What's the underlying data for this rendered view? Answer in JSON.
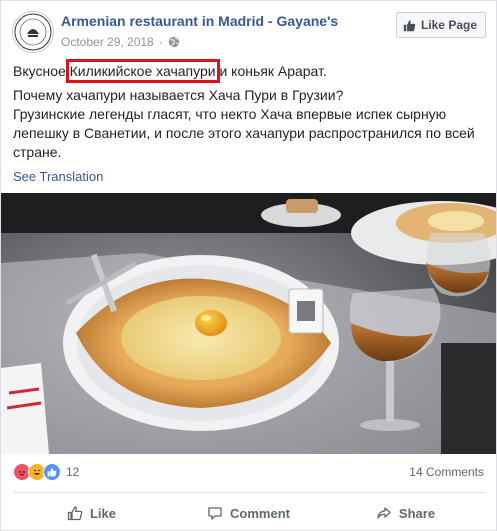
{
  "header": {
    "page_name": "Armenian restaurant in Madrid - Gayane's",
    "date": "October 29, 2018",
    "separator": "·",
    "like_page_label": "Like Page",
    "avatar_text": "GAYANE'S MADRID"
  },
  "post": {
    "line1_prefix": "Вкусное ",
    "line1_highlight": "Киликийское хачапури",
    "line1_suffix": " и коньяк Арарат.",
    "line2": "Почему хачапури называется Хача Пури в Грузии?",
    "line3": "Грузинские легенды гласят, что некто Хача впервые испек сырную лепешку в Сванетии, и после этого хачапури распространился по всей стране.",
    "see_translation": "See Translation",
    "highlight_color": "#e0101b"
  },
  "stats": {
    "reaction_count": "12",
    "comments": "14 Comments",
    "reactions": [
      "angry-icon",
      "haha-icon",
      "like-icon"
    ]
  },
  "actions": {
    "like": "Like",
    "comment": "Comment",
    "share": "Share"
  },
  "colors": {
    "link": "#365899",
    "meta": "#90949c",
    "action": "#606770"
  }
}
